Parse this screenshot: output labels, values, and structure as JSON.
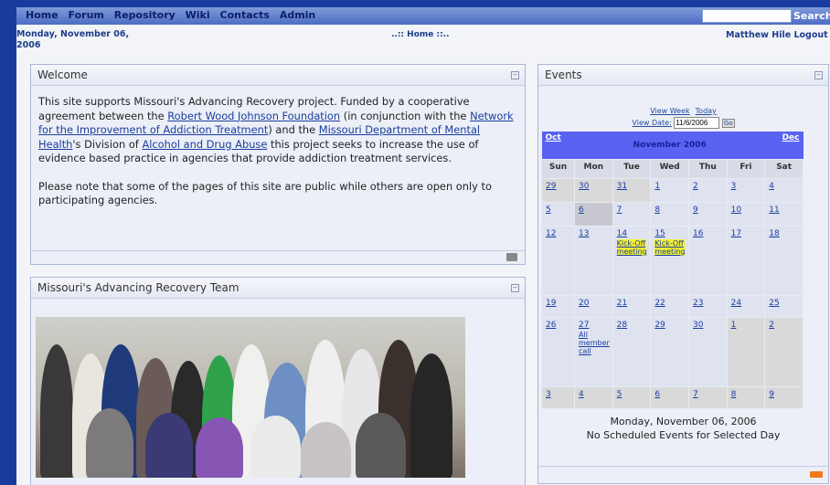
{
  "nav": {
    "items": [
      "Home",
      "Forum",
      "Repository",
      "Wiki",
      "Contacts",
      "Admin"
    ],
    "search_label": "Search",
    "search_value": ""
  },
  "header": {
    "date": "Monday, November 06, 2006",
    "breadcrumb": "..:: Home ::..",
    "user": "Matthew Hile",
    "logout": "Logout"
  },
  "welcome": {
    "title": "Welcome",
    "p1_a": "This site supports Missouri's Advancing Recovery project. Funded by a cooperative agreement between the ",
    "link1": "Robert Wood Johnson Foundation",
    "p1_b": " (in conjunction with the ",
    "link2": "Network for the Improvement of Addiction Treatment",
    "p1_c": ") and the ",
    "link3": "Missouri Department of Mental Health",
    "p1_d": "'s Division of ",
    "link4": "Alcohol and Drug Abuse",
    "p1_e": " this project seeks to increase the use of evidence based practice in agencies that provide addiction treatment services.",
    "p2": "Please note that some of the pages of this site are public while others are open only to participating agencies."
  },
  "team": {
    "title": "Missouri's Advancing Recovery Team"
  },
  "events": {
    "title": "Events",
    "view_week": "View Week",
    "today": "Today",
    "view_date_label": "View Date:",
    "view_date_value": "11/6/2006",
    "go": "Go",
    "prev": "Oct",
    "month": "November 2006",
    "next": "Dec",
    "days": [
      "Sun",
      "Mon",
      "Tue",
      "Wed",
      "Thu",
      "Fri",
      "Sat"
    ],
    "selected_date": "Monday, November 06, 2006",
    "no_events": "No Scheduled Events for Selected Day",
    "weeks": [
      [
        "29",
        "30",
        "31",
        "1",
        "2",
        "3",
        "4"
      ],
      [
        "5",
        "6",
        "7",
        "8",
        "9",
        "10",
        "11"
      ],
      [
        "12",
        "13",
        "14",
        "15",
        "16",
        "17",
        "18"
      ],
      [
        "19",
        "20",
        "21",
        "22",
        "23",
        "24",
        "25"
      ],
      [
        "26",
        "27",
        "28",
        "29",
        "30",
        "1",
        "2"
      ],
      [
        "3",
        "4",
        "5",
        "6",
        "7",
        "8",
        "9"
      ]
    ],
    "event_kickoff": "Kick-Off meeting",
    "event_member": "All member call"
  },
  "colors": {
    "accent": "#1a3b9e",
    "calendar_header": "#5a62f2",
    "event_highlight": "#f3f030"
  }
}
